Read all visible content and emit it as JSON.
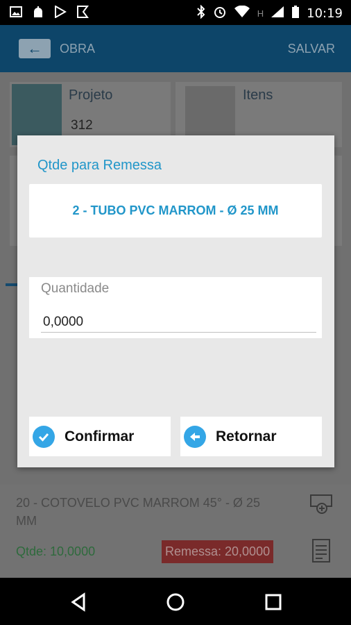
{
  "status_bar": {
    "time": "10:19",
    "left_icons": [
      "image-icon",
      "android-icon",
      "play-store-icon",
      "check-app-icon"
    ],
    "right_icons": [
      "bluetooth-icon",
      "alarm-icon",
      "wifi-icon",
      "signal-icon",
      "battery-icon"
    ],
    "signal_label": "H"
  },
  "app_bar": {
    "title": "OBRA",
    "save_label": "SALVAR",
    "back_icon": "arrow-left-icon"
  },
  "background": {
    "card1_title": "Projeto",
    "card1_value": "312",
    "card2_title": "Itens",
    "list_item_text_line1": "20 - COTOVELO PVC MARROM 45° - Ø 25",
    "list_item_text_line2": "MM",
    "list_item_qtde": "Qtde: 10,0000",
    "list_item_remessa": "Remessa: 20,0000"
  },
  "dialog": {
    "title": "Qtde para Remessa",
    "item_label": "2 - TUBO PVC MARROM - Ø 25 MM",
    "quantity_label": "Quantidade",
    "quantity_value": "0,0000",
    "confirm_label": "Confirmar",
    "return_label": "Retornar"
  },
  "colors": {
    "accent": "#2196c9",
    "button_icon": "#34a6e6",
    "app_bar": "#1565a0"
  }
}
